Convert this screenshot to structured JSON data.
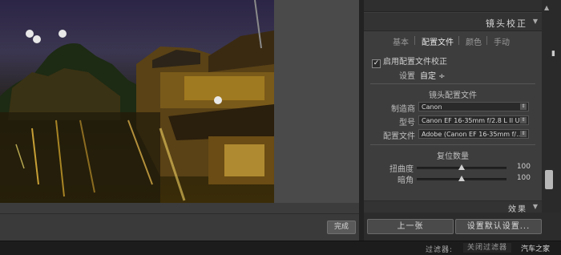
{
  "panel": {
    "header_title": "镜头校正",
    "tabs": [
      "基本",
      "配置文件",
      "颜色",
      "手动"
    ],
    "enable_profile_label": "启用配置文件校正",
    "setup_label": "设置",
    "setup_value": "自定 ÷",
    "section_lens_profile": "镜头配置文件",
    "make_label": "制造商",
    "make_value": "Canon",
    "model_label": "型号",
    "model_value": "Canon EF 16-35mm f/2.8 L II U...",
    "profile_label": "配置文件",
    "profile_value": "Adobe (Canon EF 16-35mm f/...",
    "section_amount": "复位数量",
    "distortion_label": "扭曲度",
    "distortion_value": "100",
    "vignetting_label": "暗角",
    "vignetting_value": "100",
    "effects_title": "效果"
  },
  "sliders": {
    "distortion": 0.5,
    "vignetting": 0.5
  },
  "buttons": {
    "previous": "上一张",
    "set_default": "设置默认设置...",
    "done": "完成"
  },
  "status": {
    "filter_label": "过滤器:",
    "filter_value": "关闭过滤器",
    "watermark": "汽车之家"
  },
  "colors": {
    "panel_bg": "#3d3d3d",
    "accent_text": "#e8e8e8"
  }
}
